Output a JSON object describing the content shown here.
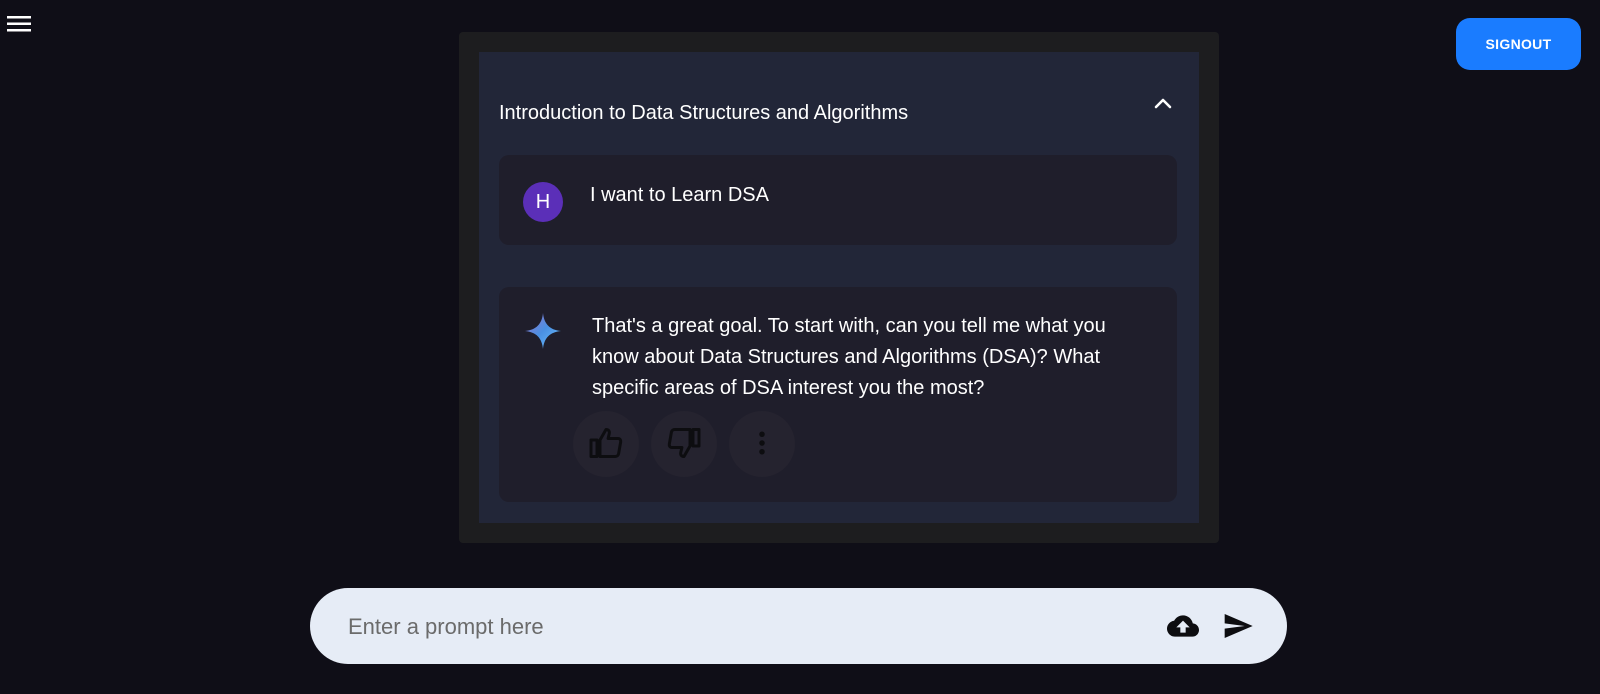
{
  "header": {
    "signout_label": "SIGNOUT"
  },
  "chat": {
    "title": "Introduction to Data Structures and Algorithms",
    "user_message": {
      "avatar_letter": "H",
      "text": "I want to Learn DSA"
    },
    "ai_message": {
      "text": "That's a great goal. To start with, can you tell me what you know about Data Structures and Algorithms (DSA)? What specific areas of DSA interest you the most?"
    }
  },
  "prompt": {
    "placeholder": "Enter a prompt here"
  },
  "icons": {
    "menu": "hamburger-menu-icon",
    "collapse": "chevron-up-icon",
    "ai": "sparkle-icon",
    "like": "thumbs-up-icon",
    "dislike": "thumbs-down-icon",
    "more": "more-vertical-icon",
    "upload": "cloud-upload-icon",
    "send": "send-icon"
  },
  "colors": {
    "background": "#0f0e17",
    "accent": "#1a7cff",
    "panel": "#222638",
    "message_bg": "#1f1e2b",
    "avatar": "#5b2fb8",
    "prompt_bar": "#e6ecf6"
  }
}
